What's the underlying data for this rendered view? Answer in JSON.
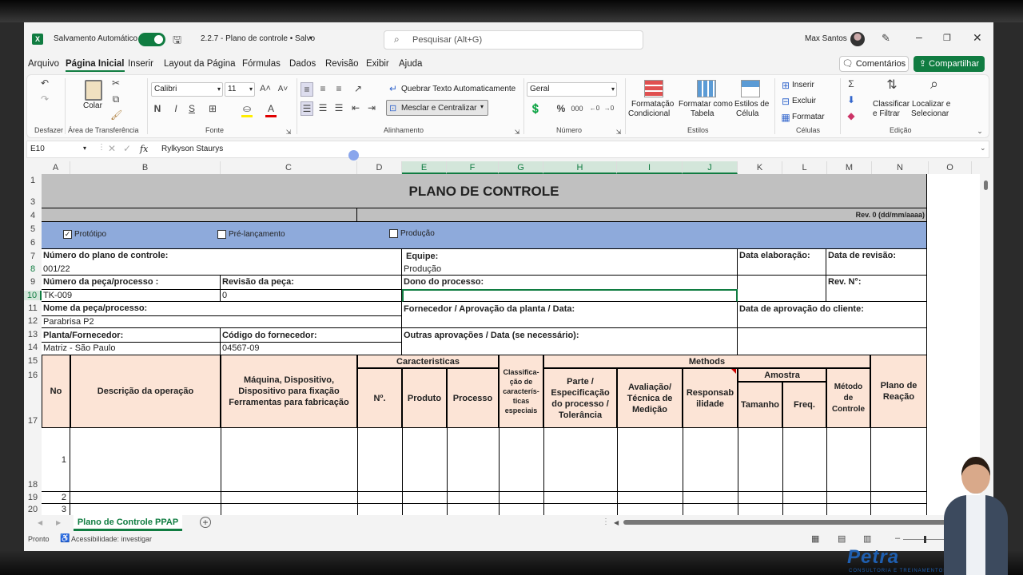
{
  "titlebar": {
    "autosave_label": "Salvamento Automático",
    "doc_title": "2.2.7 - Plano de controle • Salvo",
    "search_placeholder": "Pesquisar (Alt+G)",
    "user_name": "Max Santos"
  },
  "menu": {
    "items": [
      "Arquivo",
      "Página Inicial",
      "Inserir",
      "Layout da Página",
      "Fórmulas",
      "Dados",
      "Revisão",
      "Exibir",
      "Ajuda"
    ],
    "comments": "Comentários",
    "share": "Compartilhar"
  },
  "ribbon": {
    "undo_group": "Desfazer",
    "paste_label": "Colar",
    "clipboard_group": "Área de Transferência",
    "font_name": "Calibri",
    "font_size": "11",
    "bold": "N",
    "italic": "I",
    "underline": "S",
    "font_group": "Fonte",
    "wrap_text": "Quebrar Texto Automaticamente",
    "merge_center": "Mesclar e Centralizar",
    "alignment_group": "Alinhamento",
    "number_format": "Geral",
    "number_group": "Número",
    "cond_format": [
      "Formatação",
      "Condicional"
    ],
    "format_table": [
      "Formatar como",
      "Tabela"
    ],
    "cell_styles": [
      "Estilos de",
      "Célula"
    ],
    "styles_group": "Estilos",
    "insert": "Inserir",
    "delete": "Excluir",
    "format": "Formatar",
    "cells_group": "Células",
    "sort_filter": [
      "Classificar",
      "e Filtrar"
    ],
    "find_select": [
      "Localizar e",
      "Selecionar"
    ],
    "editing_group": "Edição"
  },
  "formula_bar": {
    "name_box": "E10",
    "fx": "fx",
    "content": "Rylkyson Staurys"
  },
  "columns": [
    "A",
    "B",
    "C",
    "D",
    "E",
    "F",
    "G",
    "H",
    "I",
    "J",
    "K",
    "L",
    "M",
    "N",
    "O"
  ],
  "rows": [
    "1",
    "3",
    "4",
    "5",
    "6",
    "7",
    "8",
    "9",
    "10",
    "11",
    "12",
    "13",
    "14",
    "15",
    "16",
    "17",
    "18",
    "19",
    "20"
  ],
  "sheet": {
    "title": "PLANO DE CONTROLE",
    "revision": "Rev. 0 (dd/mm/aaaa)",
    "cb_prototype": "Protótipo",
    "cb_prelaunch": "Pré-lançamento",
    "cb_production": "Produção",
    "control_plan_no_label": "Número do plano de controle:",
    "control_plan_no": "001/22",
    "team_label": "Equipe:",
    "team": "Produção",
    "prepared_date_label": "Data elaboração:",
    "revision_date_label": "Data de revisão:",
    "part_no_label": "Número da peça/processo :",
    "part_no": "TK-009",
    "part_rev_label": "Revisão da peça:",
    "part_rev": "0",
    "process_owner_label": "Dono do processo:",
    "rev_no_label": "Rev. N°:",
    "part_name_label": "Nome da peça/processo:",
    "part_name": "Parabrisa P2",
    "supplier_approval_label": "Fornecedor / Aprovação da planta / Data:",
    "customer_approval_label": "Data de aprovação do cliente:",
    "plant_label": "Planta/Fornecedor:",
    "plant": "Matriz - São Paulo",
    "supplier_code_label": "Código do fornecedor:",
    "supplier_code": "04567-09",
    "other_approvals_label": "Outras aprovações / Data (se necessário):",
    "h_no": "No",
    "h_op_desc": "Descrição da operação",
    "h_machine": "Máquina, Dispositivo, Dispositivo para fixação Ferramentas para fabricação",
    "h_characteristics": "Caracteristicas",
    "h_num": "Nº.",
    "h_product": "Produto",
    "h_process": "Processo",
    "h_special": "Classifica-ção de caracterís-ticas especiais",
    "h_methods": "Methods",
    "h_part_spec": "Parte / Especificação do processo / Tolerância",
    "h_eval": "Avaliação/ Técnica de Medição",
    "h_responsibility": "Responsab ilidade",
    "h_sample": "Amostra",
    "h_size": "Tamanho",
    "h_freq": "Freq.",
    "h_control_method": "Método de Controle",
    "h_reaction": "Plano de Reação",
    "row1": "1",
    "row2": "2",
    "row3": "3"
  },
  "tabs": {
    "sheet_tab": "Plano de Controle PPAP"
  },
  "status": {
    "ready": "Pronto",
    "accessibility": "Acessibilidade: investigar"
  },
  "watermark": "Petra",
  "watermark_sub": "CONSULTORIA E TREINAMENTOS"
}
